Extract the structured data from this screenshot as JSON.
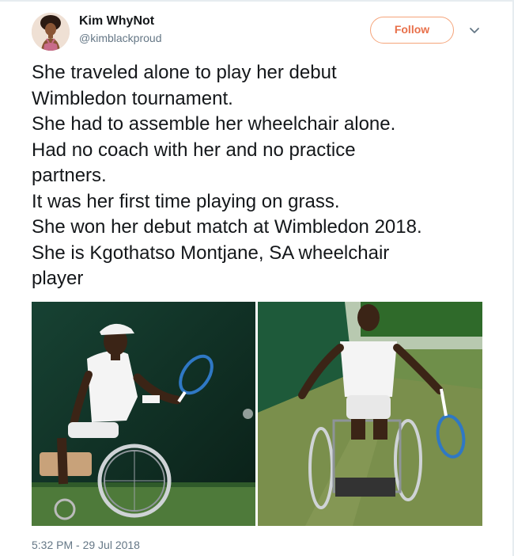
{
  "author": {
    "name": "Kim WhyNot",
    "handle": "@kimblackproud"
  },
  "follow_label": "Follow",
  "tweet_lines": [
    "She traveled alone to play her debut",
    "Wimbledon tournament.",
    "She had to assemble her wheelchair alone.",
    "Had no coach with her and no practice",
    "partners.",
    "It was her first time playing on grass.",
    "She won her debut match at Wimbledon 2018.",
    "She is Kgothatso Montjane, SA wheelchair",
    "player"
  ],
  "timestamp": "5:32 PM - 29 Jul 2018",
  "icons": {
    "menu": "chevron-down-icon",
    "gallery_nav": "arrow-right-icon"
  },
  "colors": {
    "follow_accent": "#e8704a",
    "handle": "#657786",
    "text": "#14171a"
  }
}
